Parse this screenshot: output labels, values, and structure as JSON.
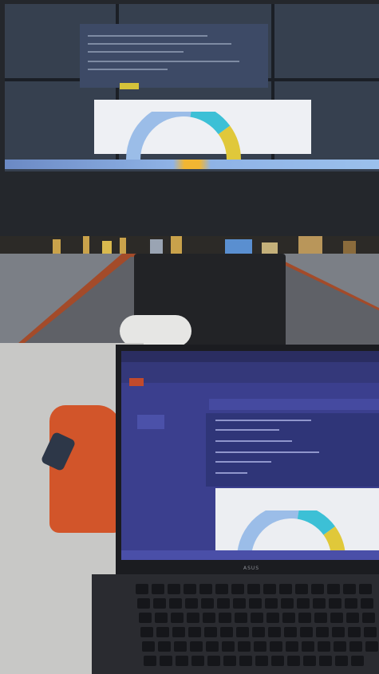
{
  "scene": {
    "colors": {
      "wall": "#24272c",
      "table_rim": "#a34b2a",
      "laptop_screen": "#3b3f8e",
      "gauge_blue": "#9bbde8",
      "gauge_cyan": "#3cc0d6",
      "gauge_yellow": "#e0c83a"
    }
  },
  "laptop": {
    "brand": "ASUS"
  },
  "chart_data": {
    "type": "pie",
    "variant": "half-donut gauge",
    "segments": [
      {
        "name": "",
        "value": 0.55,
        "color": "#9bbde8"
      },
      {
        "name": "",
        "value": 0.25,
        "color": "#3cc0d6"
      },
      {
        "name": "",
        "value": 0.2,
        "color": "#e0c83a"
      }
    ],
    "title": ""
  }
}
